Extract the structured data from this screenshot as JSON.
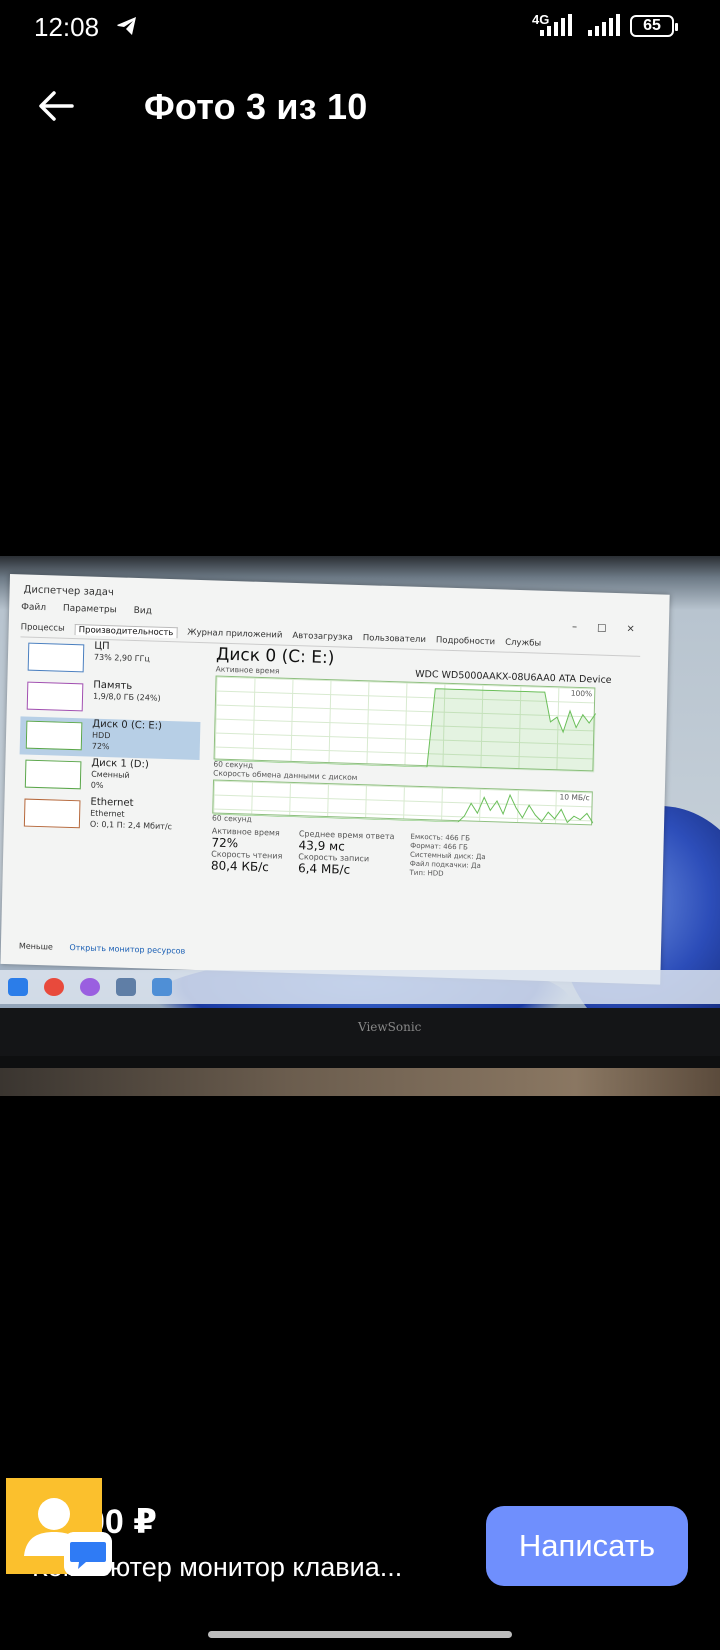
{
  "status_bar": {
    "time": "12:08",
    "network": "4G",
    "battery": "65"
  },
  "header": {
    "title": "Фото 3 из 10"
  },
  "photo": {
    "task_manager": {
      "window_title": "Диспетчер задач",
      "menu": [
        "Файл",
        "Параметры",
        "Вид"
      ],
      "tabs": [
        "Процессы",
        "Производительность",
        "Журнал приложений",
        "Автозагрузка",
        "Пользователи",
        "Подробности",
        "Службы"
      ],
      "sidebar": [
        {
          "name": "ЦП",
          "sub1": "73% 2,90 ГГц",
          "sub2": ""
        },
        {
          "name": "Память",
          "sub1": "1,9/8,0 ГБ (24%)",
          "sub2": ""
        },
        {
          "name": "Диск 0 (C: E:)",
          "sub1": "HDD",
          "sub2": "72%"
        },
        {
          "name": "Диск 1 (D:)",
          "sub1": "Сменный",
          "sub2": "0%"
        },
        {
          "name": "Ethernet",
          "sub1": "Ethernet",
          "sub2": "О: 0,1 П: 2,4 Мбит/с"
        }
      ],
      "heading": "Диск 0 (C: E:)",
      "device": "WDC WD5000AAKX-08U6AA0 ATA Device",
      "graph1_caption": "Активное время",
      "graph1_max": "100%",
      "graph2_caption": "Скорость обмена данными с диском",
      "graph2_max": "10 МБ/с",
      "axis_label": "60 секунд",
      "stats": {
        "active_time_label": "Активное время",
        "active_time": "72%",
        "avg_response_label": "Среднее время ответа",
        "avg_response": "43,9 мс",
        "read_label": "Скорость чтения",
        "read": "80,4 КБ/с",
        "write_label": "Скорость записи",
        "write": "6,4 МБ/с",
        "capacity_label": "Емкость:",
        "capacity": "466 ГБ",
        "formatted_label": "Формат:",
        "formatted": "466 ГБ",
        "system_label": "Системный диск:",
        "system": "Да",
        "pagefile_label": "Файл подкачки:",
        "pagefile": "Да",
        "type_label": "Тип:",
        "type": "HDD"
      },
      "footer_less": "Меньше",
      "footer_link": "Открыть монитор ресурсов"
    },
    "monitor_brand": "ViewSonic"
  },
  "listing": {
    "price": "00 ₽",
    "title": "Компьютер монитор клавиа..."
  },
  "actions": {
    "write_label": "Написать"
  },
  "colors": {
    "accent": "#6f8ffd",
    "avatar_bg": "#fbc02d",
    "graph_line": "#6bbf5a"
  },
  "chart_data": [
    {
      "type": "area",
      "title": "Активное время",
      "xlabel": "60 секунд",
      "ylim": [
        0,
        100
      ],
      "series": [
        {
          "name": "",
          "values": [
            0,
            0,
            0,
            0,
            0,
            0,
            0,
            0,
            0,
            0,
            0,
            0,
            0,
            0,
            0,
            0,
            0,
            0,
            0,
            0,
            0,
            0,
            0,
            0,
            0,
            0,
            0,
            0,
            0,
            0,
            0,
            0,
            0,
            0,
            96,
            96,
            96,
            96,
            96,
            96,
            96,
            96,
            96,
            96,
            96,
            96,
            96,
            96,
            96,
            96,
            96,
            96,
            60,
            66,
            48,
            74,
            54,
            70,
            60,
            72
          ]
        }
      ]
    },
    {
      "type": "line",
      "title": "Скорость обмена данными с диском",
      "xlabel": "60 секунд",
      "series": [
        {
          "name": "",
          "values": [
            0,
            0,
            0,
            0,
            0,
            0,
            0,
            0,
            0,
            0,
            0,
            0,
            0,
            0,
            0,
            0,
            0,
            0,
            0,
            0,
            0,
            0,
            0,
            0,
            0,
            0,
            0,
            0,
            0,
            0,
            0,
            0,
            0,
            0,
            0,
            0,
            0,
            0,
            0,
            2,
            6,
            3,
            8,
            4,
            7,
            3,
            9,
            5,
            2,
            6,
            3,
            1,
            4,
            2,
            5,
            1,
            3,
            2,
            4,
            1
          ]
        }
      ]
    }
  ]
}
